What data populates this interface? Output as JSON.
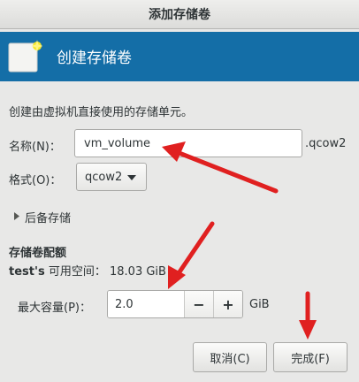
{
  "window": {
    "title": "添加存储卷"
  },
  "header": {
    "title": "创建存储卷",
    "icon": "new-volume-icon"
  },
  "description": "创建由虚拟机直接使用的存储单元。",
  "name_field": {
    "label": "名称(N)：",
    "value": "vm_volume",
    "suffix": ".qcow2"
  },
  "format_field": {
    "label": "格式(O)：",
    "selected": "qcow2"
  },
  "backing_store": {
    "label": "后备存储",
    "expanded": false
  },
  "quota": {
    "title": "存储卷配额",
    "pool_name": "test's",
    "space_label": "可用空间：",
    "space_value": "18.03 GiB",
    "capacity_label": "最大容量(P)：",
    "capacity_value": "2.0",
    "unit": "GiB",
    "decrement": "−",
    "increment": "+"
  },
  "buttons": {
    "cancel": "取消(C)",
    "finish": "完成(F)"
  },
  "colors": {
    "header_bg": "#146ea7",
    "annotation_arrow": "#e02020"
  }
}
